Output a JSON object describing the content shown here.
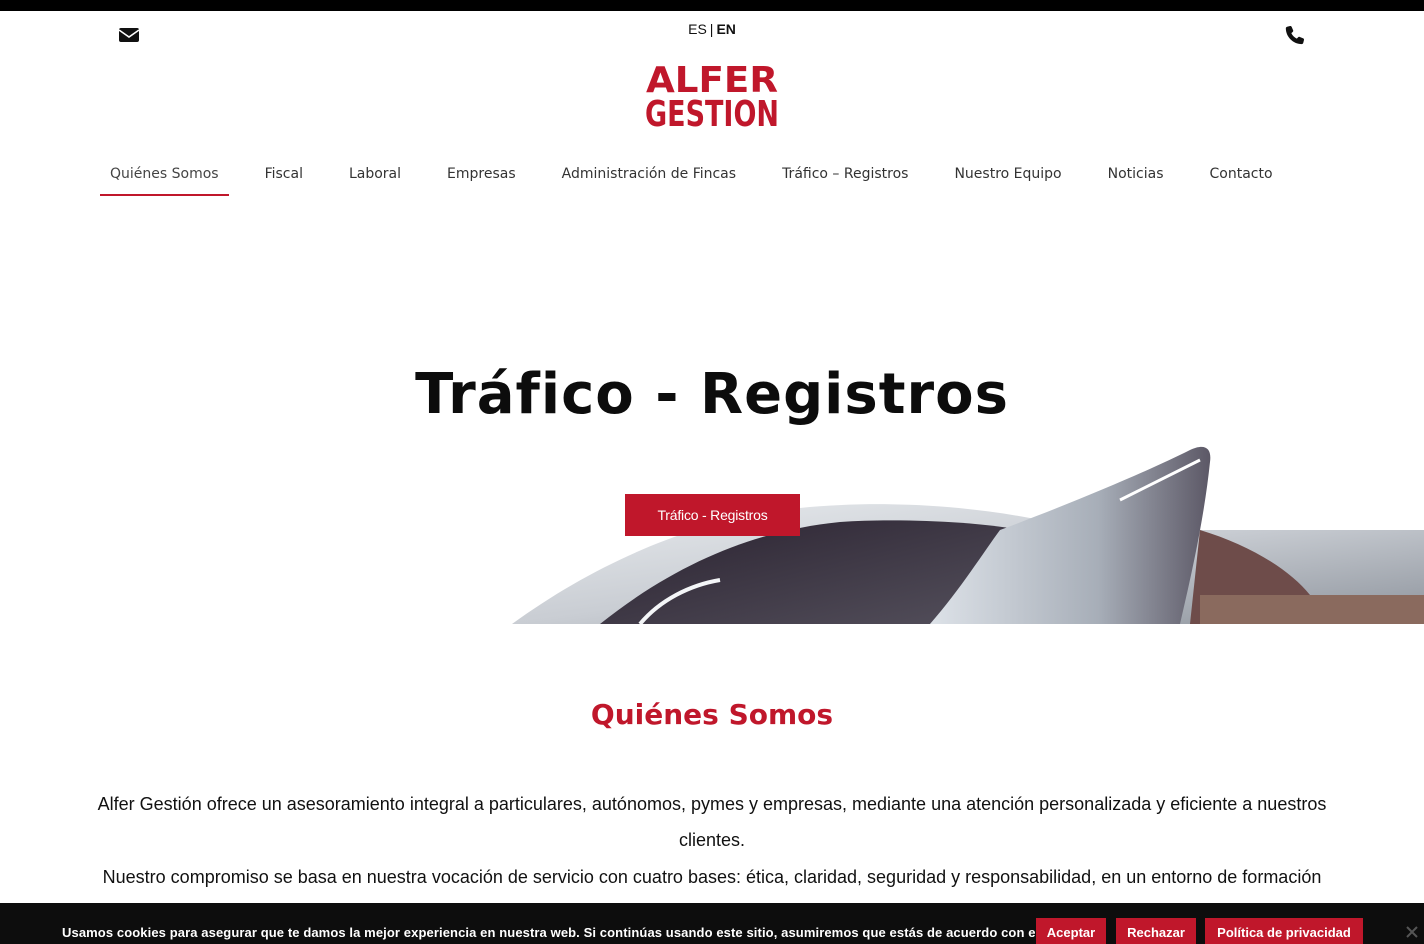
{
  "header": {
    "lang_es": "ES",
    "lang_sep": "|",
    "lang_en": "EN",
    "logo_text_line1": "ALFER",
    "logo_text_line2": "GESTION",
    "icons": [
      "envelope-icon",
      "phone-icon"
    ]
  },
  "nav": {
    "items": [
      {
        "label": "Quiénes Somos",
        "active": true
      },
      {
        "label": "Fiscal"
      },
      {
        "label": "Laboral"
      },
      {
        "label": "Empresas"
      },
      {
        "label": "Administración de Fincas"
      },
      {
        "label": "Tráfico – Registros"
      },
      {
        "label": "Nuestro Equipo"
      },
      {
        "label": "Noticias"
      },
      {
        "label": "Contacto"
      }
    ]
  },
  "hero": {
    "title": "Tráfico - Registros",
    "button_label": "Tráfico - Registros"
  },
  "about": {
    "title": "Quiénes Somos",
    "paragraph1": "Alfer Gestión ofrece un asesoramiento integral a particulares, autónomos, pymes y empresas, mediante una atención personalizada y eficiente a nuestros clientes.",
    "paragraph2": "Nuestro compromiso se basa en nuestra vocación de servicio con cuatro bases: ética, claridad, seguridad y responsabilidad, en un entorno de formación"
  },
  "cookie_bar": {
    "text": "Usamos cookies para asegurar que te damos la mejor experiencia en nuestra web. Si continúas usando este sitio, asumiremos que estás de acuerdo con ello.",
    "accept_label": "Aceptar",
    "reject_label": "Rechazar",
    "privacy_label": "Política de privacidad"
  },
  "colors": {
    "brand_red": "#c0172b",
    "top_bar": "#000000",
    "cookie_bg": "#0d0d0d"
  }
}
